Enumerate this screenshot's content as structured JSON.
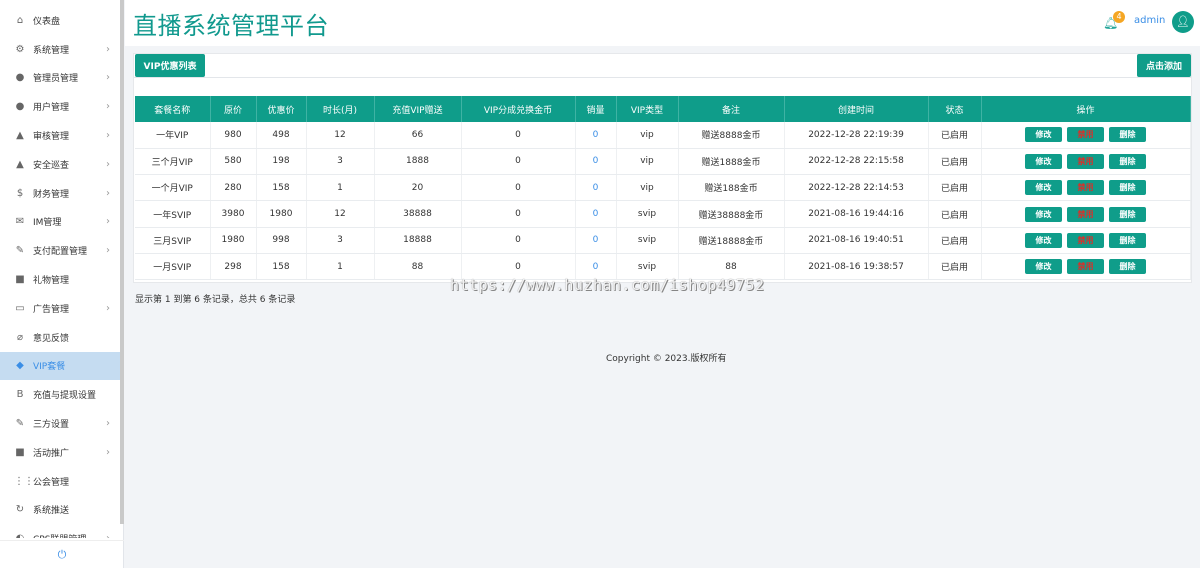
{
  "app": {
    "title": "直播系统管理平台"
  },
  "header": {
    "notification_count": "4",
    "user": "admin"
  },
  "sidebar": {
    "items": [
      {
        "label": "仪表盘",
        "icon": "home-icon",
        "glyph": "⌂",
        "chevron": false
      },
      {
        "label": "系统管理",
        "icon": "cogs-icon",
        "glyph": "⚙",
        "chevron": true
      },
      {
        "label": "管理员管理",
        "icon": "user-icon",
        "glyph": "●",
        "chevron": true
      },
      {
        "label": "用户管理",
        "icon": "user-icon",
        "glyph": "●",
        "chevron": true
      },
      {
        "label": "审核管理",
        "icon": "warning-icon",
        "glyph": "▲",
        "chevron": true
      },
      {
        "label": "安全巡查",
        "icon": "warning-icon",
        "glyph": "▲",
        "chevron": true
      },
      {
        "label": "财务管理",
        "icon": "dollar-icon",
        "glyph": "$",
        "chevron": true
      },
      {
        "label": "IM管理",
        "icon": "envelope-icon",
        "glyph": "✉",
        "chevron": true
      },
      {
        "label": "支付配置管理",
        "icon": "wrench-icon",
        "glyph": "✎",
        "chevron": true
      },
      {
        "label": "礼物管理",
        "icon": "gift-icon",
        "glyph": "■",
        "chevron": false
      },
      {
        "label": "广告管理",
        "icon": "desktop-icon",
        "glyph": "▭",
        "chevron": true
      },
      {
        "label": "意见反馈",
        "icon": "paperclip-icon",
        "glyph": "⌀",
        "chevron": false
      },
      {
        "label": "VIP套餐",
        "icon": "diamond-icon",
        "glyph": "◆",
        "chevron": false,
        "active": true
      },
      {
        "label": "充值与提现设置",
        "icon": "bitcoin-icon",
        "glyph": "B",
        "chevron": false
      },
      {
        "label": "三方设置",
        "icon": "wrench-icon",
        "glyph": "✎",
        "chevron": true
      },
      {
        "label": "活动推广",
        "icon": "briefcase-icon",
        "glyph": "■",
        "chevron": true
      },
      {
        "label": "公会管理",
        "icon": "grid-icon",
        "glyph": "⋮⋮",
        "chevron": false
      },
      {
        "label": "系统推送",
        "icon": "refresh-icon",
        "glyph": "↻",
        "chevron": false
      },
      {
        "label": "CPS联盟管理",
        "icon": "globe-icon",
        "glyph": "◐",
        "chevron": true
      }
    ],
    "footer_icon": "power-icon"
  },
  "main": {
    "tab_label": "VIP优惠列表",
    "add_label": "点击添加",
    "columns": [
      "套餐名称",
      "原价",
      "优惠价",
      "时长(月)",
      "充值VIP赠送",
      "VIP分成兑换金币",
      "销量",
      "VIP类型",
      "备注",
      "创建时间",
      "状态",
      "操作"
    ],
    "rows": [
      [
        "一年VIP",
        "980",
        "498",
        "12",
        "66",
        "0",
        "0",
        "vip",
        "赠送8888金币",
        "2022-12-28 22:19:39",
        "已启用"
      ],
      [
        "三个月VIP",
        "580",
        "198",
        "3",
        "1888",
        "0",
        "0",
        "vip",
        "赠送1888金币",
        "2022-12-28 22:15:58",
        "已启用"
      ],
      [
        "一个月VIP",
        "280",
        "158",
        "1",
        "20",
        "0",
        "0",
        "vip",
        "赠送188金币",
        "2022-12-28 22:14:53",
        "已启用"
      ],
      [
        "一年SVIP",
        "3980",
        "1980",
        "12",
        "38888",
        "0",
        "0",
        "svip",
        "赠送38888金币",
        "2021-08-16 19:44:16",
        "已启用"
      ],
      [
        "三月SVIP",
        "1980",
        "998",
        "3",
        "18888",
        "0",
        "0",
        "svip",
        "赠送18888金币",
        "2021-08-16 19:40:51",
        "已启用"
      ],
      [
        "一月SVIP",
        "298",
        "158",
        "1",
        "88",
        "0",
        "0",
        "svip",
        "88",
        "2021-08-16 19:38:57",
        "已启用"
      ]
    ],
    "actions": {
      "edit": "修改",
      "disable": "禁用",
      "delete": "删除"
    },
    "pager_info": "显示第 1 到第 6 条记录，总共 6 条记录",
    "copyright": "Copyright © 2023.版权所有",
    "watermark": "https://www.huzhan.com/ishop49752"
  },
  "colors": {
    "primary": "#0f9d8a",
    "link": "#3a8ee6",
    "danger": "#d9302a",
    "badge": "#f5a623"
  }
}
